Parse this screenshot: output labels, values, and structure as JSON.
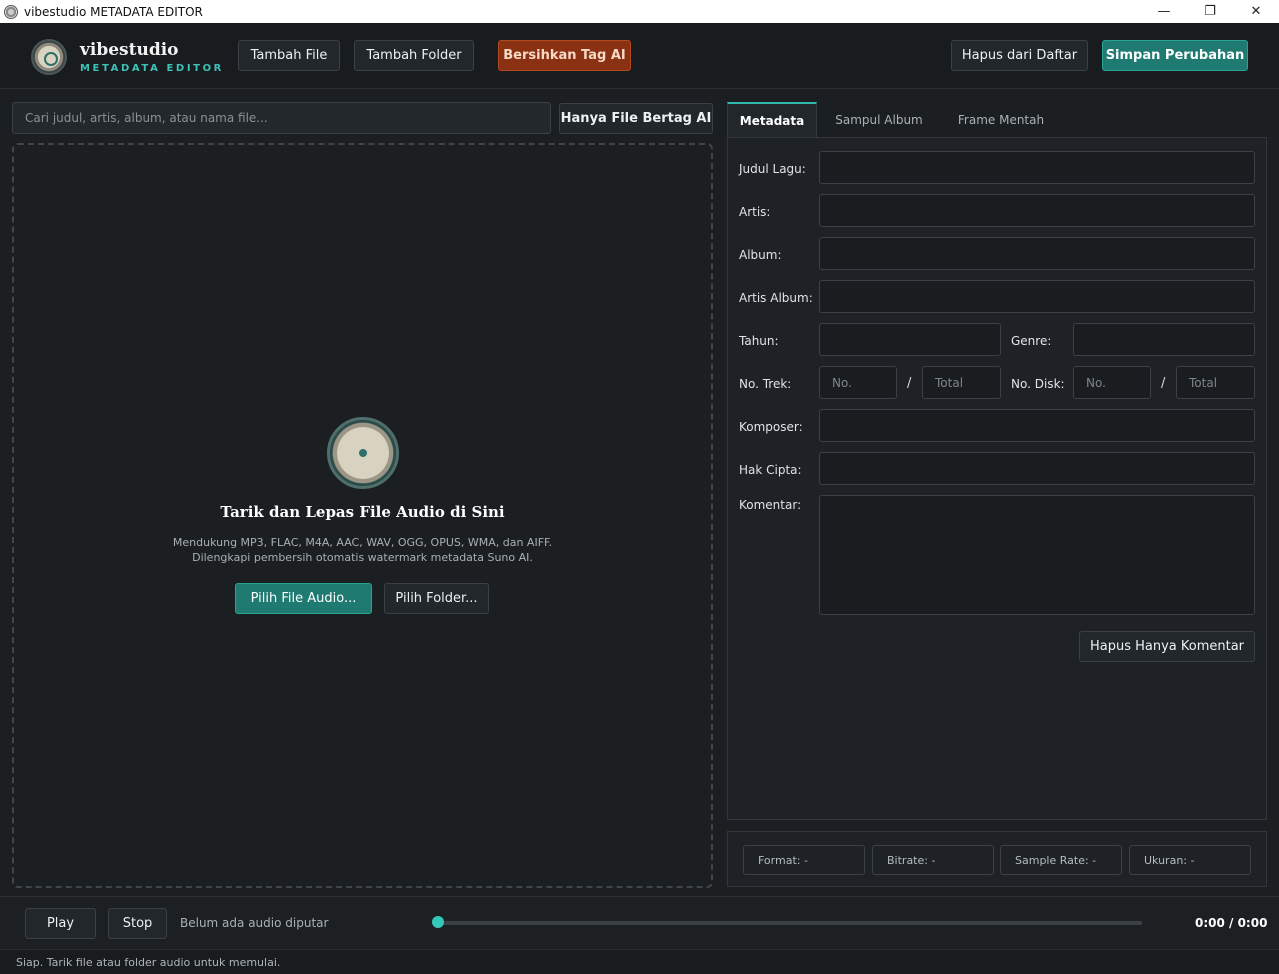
{
  "window": {
    "title": "vibestudio METADATA EDITOR",
    "minimize": "—",
    "maximize": "❐",
    "close": "✕"
  },
  "header": {
    "brand_name": "vibestudio",
    "brand_sub": "METADATA EDITOR",
    "add_file": "Tambah File",
    "add_folder": "Tambah Folder",
    "clean_ai": "Bersihkan Tag AI",
    "remove_list": "Hapus dari Daftar",
    "save": "Simpan Perubahan"
  },
  "left": {
    "search_placeholder": "Cari judul, artis, album, atau nama file...",
    "filter_ai": "Hanya File Bertag AI",
    "drop_title": "Tarik dan Lepas File Audio di Sini",
    "drop_desc1": "Mendukung MP3, FLAC, M4A, AAC, WAV, OGG, OPUS, WMA, dan AIFF.",
    "drop_desc2": "Dilengkapi pembersih otomatis watermark metadata Suno AI.",
    "choose_file": "Pilih File Audio...",
    "choose_folder": "Pilih Folder..."
  },
  "tabs": [
    "Metadata",
    "Sampul Album",
    "Frame Mentah"
  ],
  "form": {
    "title": "Judul Lagu:",
    "artist": "Artis:",
    "album": "Album:",
    "album_artist": "Artis Album:",
    "year": "Tahun:",
    "genre": "Genre:",
    "track_no": "No. Trek:",
    "disk_no": "No. Disk:",
    "no_ph": "No.",
    "total_ph": "Total",
    "slash": "/",
    "composer": "Komposer:",
    "copyright": "Hak Cipta:",
    "comment": "Komentar:",
    "clear_comment": "Hapus Hanya Komentar"
  },
  "info": {
    "format": "Format: -",
    "bitrate": "Bitrate: -",
    "sample_rate": "Sample Rate: -",
    "size": "Ukuran: -"
  },
  "player": {
    "play": "Play",
    "stop": "Stop",
    "now_playing": "Belum ada audio diputar",
    "time": "0:00 / 0:00",
    "progress": 0
  },
  "status": "Siap. Tarik file atau folder audio untuk memulai.",
  "colors": {
    "accent": "#2fb8aa",
    "danger": "#8a3113",
    "background": "#1b1f22"
  }
}
